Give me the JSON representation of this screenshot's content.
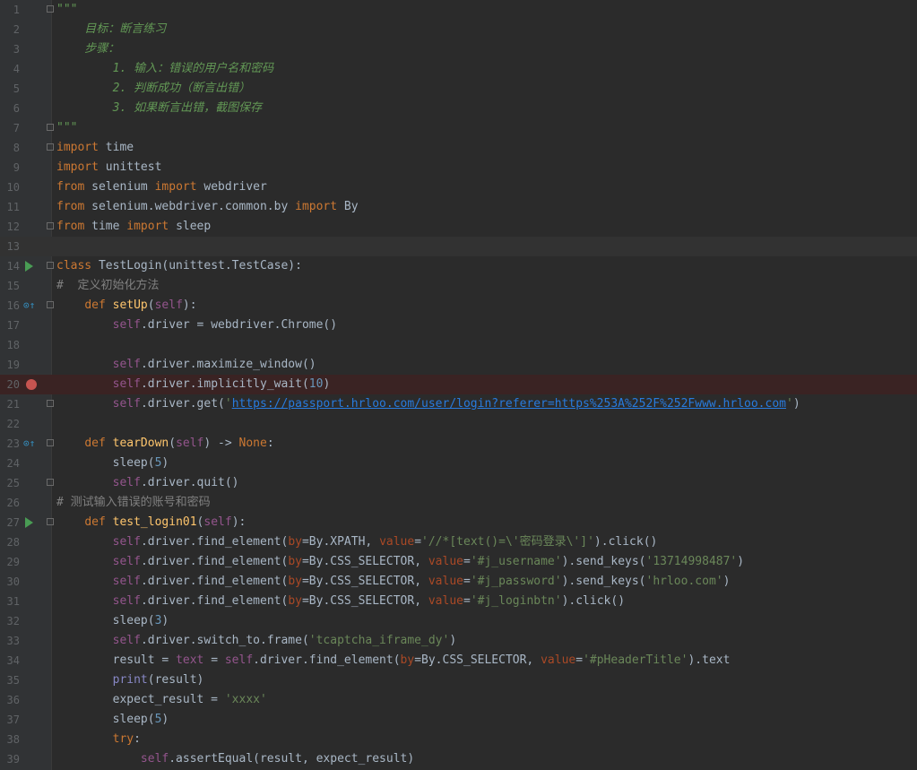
{
  "editor": {
    "lines": [
      {
        "n": "1",
        "t": "\"\"\""
      },
      {
        "n": "2",
        "t": "    目标：断言练习"
      },
      {
        "n": "3",
        "t": "    步骤："
      },
      {
        "n": "4",
        "t": "        1. 输入：错误的用户名和密码"
      },
      {
        "n": "5",
        "t": "        2. 判断成功（断言出错）"
      },
      {
        "n": "6",
        "t": "        3. 如果断言出错，截图保存"
      },
      {
        "n": "7",
        "t": "\"\"\""
      },
      {
        "n": "8",
        "t": "import time"
      },
      {
        "n": "9",
        "t": "import unittest"
      },
      {
        "n": "10",
        "t": "from selenium import webdriver"
      },
      {
        "n": "11",
        "t": "from selenium.webdriver.common.by import By"
      },
      {
        "n": "12",
        "t": "from time import sleep"
      },
      {
        "n": "13",
        "t": ""
      },
      {
        "n": "14",
        "t": "class TestLogin(unittest.TestCase):"
      },
      {
        "n": "15",
        "t": "#  定义初始化方法"
      },
      {
        "n": "16",
        "t": "    def setUp(self):"
      },
      {
        "n": "17",
        "t": "        self.driver = webdriver.Chrome()"
      },
      {
        "n": "18",
        "t": ""
      },
      {
        "n": "19",
        "t": "        self.driver.maximize_window()"
      },
      {
        "n": "20",
        "t": "        self.driver.implicitly_wait(10)"
      },
      {
        "n": "21",
        "t": "        self.driver.get('https://passport.hrloo.com/user/login?referer=https%253A%252F%252Fwww.hrloo.com')"
      },
      {
        "n": "22",
        "t": ""
      },
      {
        "n": "23",
        "t": "    def tearDown(self) -> None:"
      },
      {
        "n": "24",
        "t": "        sleep(5)"
      },
      {
        "n": "25",
        "t": "        self.driver.quit()"
      },
      {
        "n": "26",
        "t": "# 测试输入错误的账号和密码"
      },
      {
        "n": "27",
        "t": "    def test_login01(self):"
      },
      {
        "n": "28",
        "t": "        self.driver.find_element(by=By.XPATH, value='//*[text()=\\'密码登录\\']').click()"
      },
      {
        "n": "29",
        "t": "        self.driver.find_element(by=By.CSS_SELECTOR, value='#j_username').send_keys('13714998487')"
      },
      {
        "n": "30",
        "t": "        self.driver.find_element(by=By.CSS_SELECTOR, value='#j_password').send_keys('hrloo.com')"
      },
      {
        "n": "31",
        "t": "        self.driver.find_element(by=By.CSS_SELECTOR, value='#j_loginbtn').click()"
      },
      {
        "n": "32",
        "t": "        sleep(3)"
      },
      {
        "n": "33",
        "t": "        self.driver.switch_to.frame('tcaptcha_iframe_dy')"
      },
      {
        "n": "34",
        "t": "        result = text = self.driver.find_element(by=By.CSS_SELECTOR, value='#pHeaderTitle').text"
      },
      {
        "n": "35",
        "t": "        print(result)"
      },
      {
        "n": "36",
        "t": "        expect_result = 'xxxx'"
      },
      {
        "n": "37",
        "t": "        sleep(5)"
      },
      {
        "n": "38",
        "t": "        try:"
      },
      {
        "n": "39",
        "t": "            self.assertEqual(result, expect_result)"
      }
    ]
  },
  "colors": {
    "background": "#2b2b2b",
    "keyword": "#cc7832",
    "string": "#6a8759",
    "docstring": "#629755",
    "function": "#ffc66d",
    "self": "#94558d",
    "number": "#6897bb",
    "breakpoint": "#c75450",
    "run": "#499c54"
  }
}
